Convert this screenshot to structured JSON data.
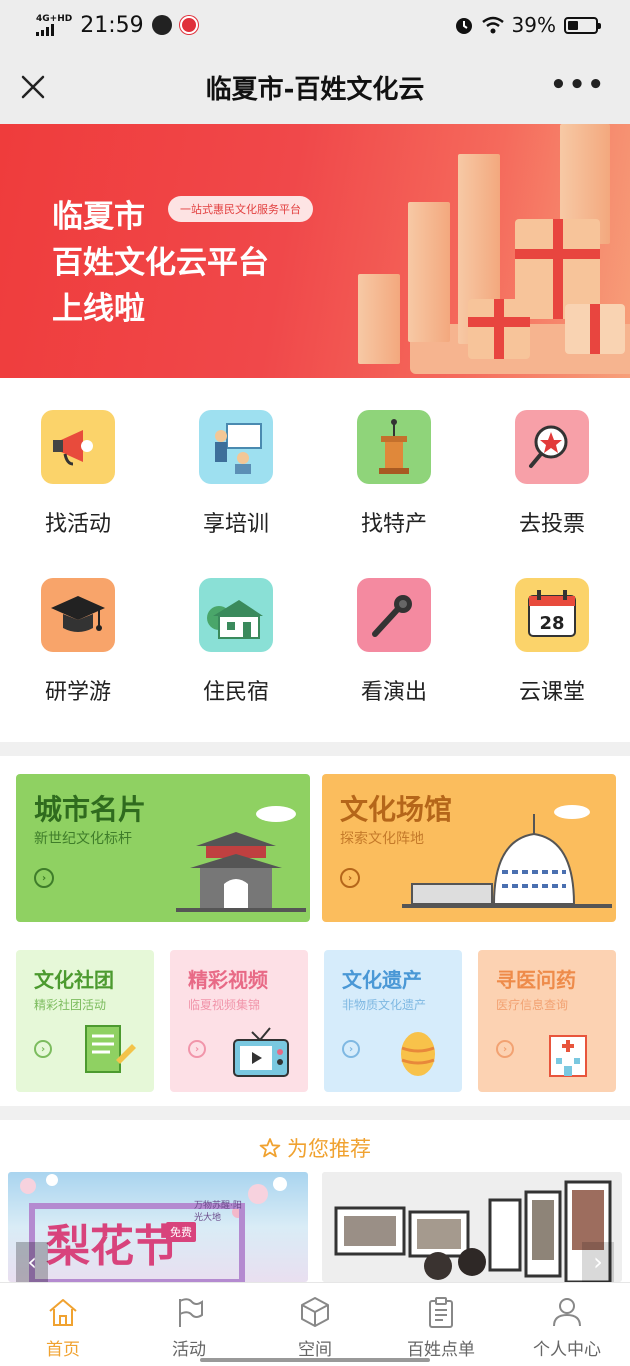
{
  "status_bar": {
    "network": "4G+HD",
    "time": "21:59",
    "battery": "39%",
    "battery_level": 0.39
  },
  "title_bar": {
    "title": "临夏市-百姓文化云",
    "more": "•••"
  },
  "banner": {
    "line1": "临夏市",
    "line2": "百姓文化云平台",
    "line3": "上线啦",
    "tag": "一站式惠民文化服务平台"
  },
  "grid": [
    {
      "label": "找活动",
      "icon": "megaphone-icon",
      "bg": "#fbd36a"
    },
    {
      "label": "享培训",
      "icon": "training-icon",
      "bg": "#9ee0f0"
    },
    {
      "label": "找特产",
      "icon": "podium-icon",
      "bg": "#8fd47a"
    },
    {
      "label": "去投票",
      "icon": "vote-icon",
      "bg": "#f7a0a8"
    },
    {
      "label": "研学游",
      "icon": "graduation-cap-icon",
      "bg": "#f8a46a"
    },
    {
      "label": "住民宿",
      "icon": "house-icon",
      "bg": "#8ae0d6"
    },
    {
      "label": "看演出",
      "icon": "microphone-icon",
      "bg": "#f48aa0"
    },
    {
      "label": "云课堂",
      "icon": "calendar-icon",
      "bg": "#fbd36a",
      "day": "28"
    }
  ],
  "big_cards": [
    {
      "title": "城市名片",
      "subtitle": "新世纪文化标杆",
      "bg": "#8fd162",
      "color": "#2f6b1e"
    },
    {
      "title": "文化场馆",
      "subtitle": "探索文化阵地",
      "bg": "#fbbd5d",
      "color": "#b5661a"
    }
  ],
  "small_cards": [
    {
      "title": "文化社团",
      "subtitle": "精彩社团活动",
      "bg": "#e6f8d8",
      "color": "#4c9a2f"
    },
    {
      "title": "精彩视频",
      "subtitle": "临夏视频集锦",
      "bg": "#fde0e6",
      "color": "#e86a86"
    },
    {
      "title": "文化遗产",
      "subtitle": "非物质文化遗产",
      "bg": "#d6ecfb",
      "color": "#4a98d6"
    },
    {
      "title": "寻医问药",
      "subtitle": "医疗信息查询",
      "bg": "#fcd2b2",
      "color": "#ee8b4a"
    }
  ],
  "recommend": {
    "label": "为您推荐"
  },
  "photos": {
    "left_text": "梨花节",
    "left_side_text": "万物苏醒·阳光大地",
    "left_badge": "免费"
  },
  "tabs": [
    {
      "label": "首页",
      "active": true
    },
    {
      "label": "活动",
      "active": false
    },
    {
      "label": "空间",
      "active": false
    },
    {
      "label": "百姓点单",
      "active": false
    },
    {
      "label": "个人中心",
      "active": false
    }
  ],
  "colors": {
    "accent": "#f0a230",
    "banner": "#ef3c3c"
  }
}
